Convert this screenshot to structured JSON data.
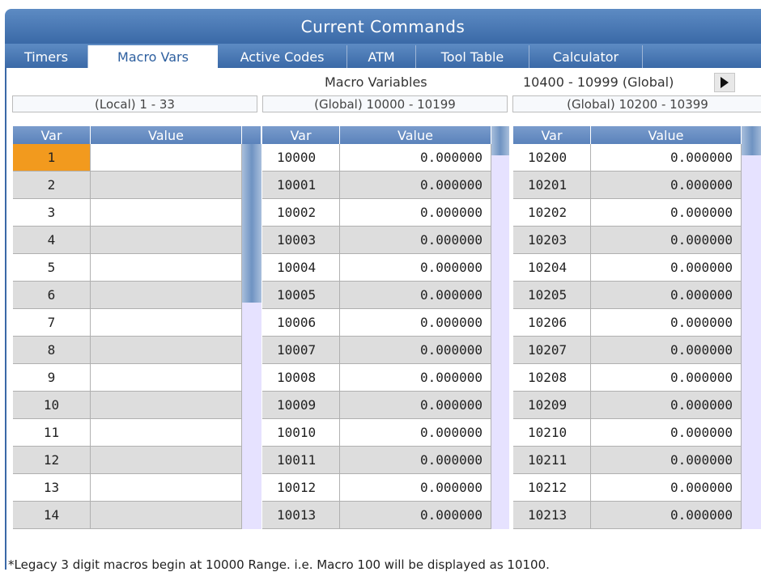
{
  "window": {
    "title": "Current Commands"
  },
  "tabs": [
    {
      "label": "Timers",
      "active": false
    },
    {
      "label": "Macro Vars",
      "active": true
    },
    {
      "label": "Active Codes",
      "active": false
    },
    {
      "label": "ATM",
      "active": false
    },
    {
      "label": "Tool Table",
      "active": false
    },
    {
      "label": "Calculator",
      "active": false
    }
  ],
  "header": {
    "title": "Macro Variables",
    "next_range": "10400 - 10999 (Global)",
    "next_icon": "play-right-icon"
  },
  "ranges": {
    "local": "(Local) 1 - 33",
    "global1": "(Global) 10000 - 10199",
    "global2": "(Global) 10200 - 10399"
  },
  "columns": {
    "var": "Var",
    "value": "Value"
  },
  "local_table": {
    "rows": [
      {
        "var": "1",
        "value": ""
      },
      {
        "var": "2",
        "value": ""
      },
      {
        "var": "3",
        "value": ""
      },
      {
        "var": "4",
        "value": ""
      },
      {
        "var": "5",
        "value": ""
      },
      {
        "var": "6",
        "value": ""
      },
      {
        "var": "7",
        "value": ""
      },
      {
        "var": "8",
        "value": ""
      },
      {
        "var": "9",
        "value": ""
      },
      {
        "var": "10",
        "value": ""
      },
      {
        "var": "11",
        "value": ""
      },
      {
        "var": "12",
        "value": ""
      },
      {
        "var": "13",
        "value": ""
      },
      {
        "var": "14",
        "value": ""
      }
    ],
    "selected": "1"
  },
  "global1_table": {
    "rows": [
      {
        "var": "10000",
        "value": "0.000000"
      },
      {
        "var": "10001",
        "value": "0.000000"
      },
      {
        "var": "10002",
        "value": "0.000000"
      },
      {
        "var": "10003",
        "value": "0.000000"
      },
      {
        "var": "10004",
        "value": "0.000000"
      },
      {
        "var": "10005",
        "value": "0.000000"
      },
      {
        "var": "10006",
        "value": "0.000000"
      },
      {
        "var": "10007",
        "value": "0.000000"
      },
      {
        "var": "10008",
        "value": "0.000000"
      },
      {
        "var": "10009",
        "value": "0.000000"
      },
      {
        "var": "10010",
        "value": "0.000000"
      },
      {
        "var": "10011",
        "value": "0.000000"
      },
      {
        "var": "10012",
        "value": "0.000000"
      },
      {
        "var": "10013",
        "value": "0.000000"
      }
    ]
  },
  "global2_table": {
    "rows": [
      {
        "var": "10200",
        "value": "0.000000"
      },
      {
        "var": "10201",
        "value": "0.000000"
      },
      {
        "var": "10202",
        "value": "0.000000"
      },
      {
        "var": "10203",
        "value": "0.000000"
      },
      {
        "var": "10204",
        "value": "0.000000"
      },
      {
        "var": "10205",
        "value": "0.000000"
      },
      {
        "var": "10206",
        "value": "0.000000"
      },
      {
        "var": "10207",
        "value": "0.000000"
      },
      {
        "var": "10208",
        "value": "0.000000"
      },
      {
        "var": "10209",
        "value": "0.000000"
      },
      {
        "var": "10210",
        "value": "0.000000"
      },
      {
        "var": "10211",
        "value": "0.000000"
      },
      {
        "var": "10212",
        "value": "0.000000"
      },
      {
        "var": "10213",
        "value": "0.000000"
      }
    ]
  },
  "footnote": "*Legacy 3 digit macros begin at 10000 Range.  i.e. Macro 100 will be displayed as 10100.",
  "colors": {
    "accent": "#3a69a7",
    "selected": "#f29a1e",
    "row_alt": "#dddddd"
  }
}
